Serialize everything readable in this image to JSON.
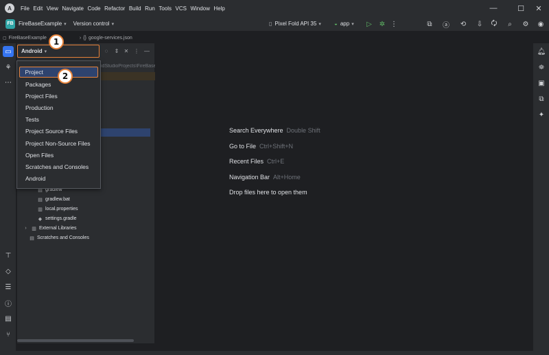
{
  "menubar": [
    "File",
    "Edit",
    "View",
    "Navigate",
    "Code",
    "Refactor",
    "Build",
    "Run",
    "Tools",
    "VCS",
    "Window",
    "Help"
  ],
  "app_logo": "A",
  "window_controls": {
    "minimize": "—",
    "maximize": "☐",
    "close": "✕"
  },
  "toolbar": {
    "project_badge": "FB",
    "project_name": "FireBaseExample",
    "vcs_label": "Version control",
    "device": "Pixel Fold API 35",
    "run_config": "app"
  },
  "breadcrumb": {
    "project": "FireBaseExample",
    "file": "google-services.json"
  },
  "panel": {
    "view_selector": "Android",
    "path_peek": "idStudioProjects\\FireBase"
  },
  "dropdown": {
    "items": [
      "Project",
      "Packages",
      "Project Files",
      "Production",
      "Tests",
      "Project Source Files",
      "Project Non-Source Files",
      "Open Files",
      "Scratches and Consoles",
      "Android"
    ],
    "selected": "Project"
  },
  "tree": [
    {
      "label": "gradlew",
      "icon": "file-icon"
    },
    {
      "label": "gradlew.bat",
      "icon": "file-icon"
    },
    {
      "label": "local.properties",
      "icon": "properties-icon"
    },
    {
      "label": "settings.gradle",
      "icon": "gradle-icon"
    },
    {
      "label": "External Libraries",
      "icon": "library-icon"
    },
    {
      "label": "Scratches and Consoles",
      "icon": "scratch-icon"
    }
  ],
  "callouts": [
    "1",
    "2"
  ],
  "editor_hints": [
    {
      "label": "Search Everywhere",
      "shortcut": "Double Shift"
    },
    {
      "label": "Go to File",
      "shortcut": "Ctrl+Shift+N"
    },
    {
      "label": "Recent Files",
      "shortcut": "Ctrl+E"
    },
    {
      "label": "Navigation Bar",
      "shortcut": "Alt+Home"
    },
    {
      "label": "Drop files here to open them",
      "shortcut": ""
    }
  ],
  "colors": {
    "accent": "#3574f0",
    "highlight": "#e8833a",
    "selection": "#2e436e",
    "background": "#1e1f22",
    "panel": "#2b2d30"
  }
}
